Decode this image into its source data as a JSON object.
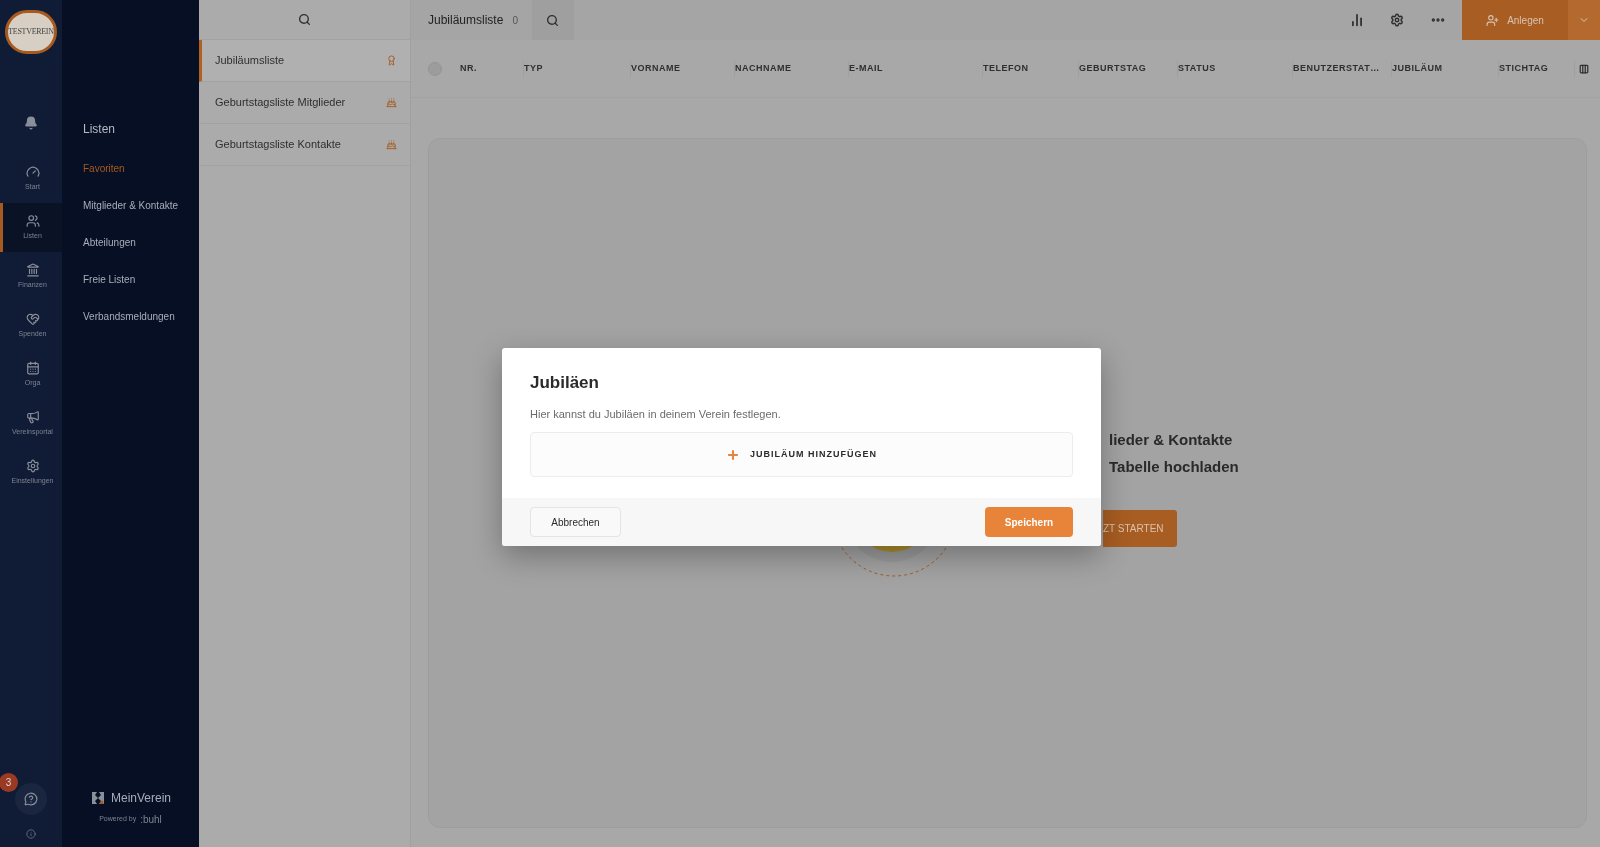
{
  "rail": {
    "logo_text": "TESTVEREIN",
    "items": [
      {
        "kind": "gauge",
        "label": "Start",
        "selected": false
      },
      {
        "kind": "users",
        "label": "Listen",
        "selected": true
      },
      {
        "kind": "bank",
        "label": "Finanzen",
        "selected": false
      },
      {
        "kind": "heart",
        "label": "Spenden",
        "selected": false
      },
      {
        "kind": "calendar",
        "label": "Orga",
        "selected": false
      },
      {
        "kind": "megaphone",
        "label": "Vereinsportal",
        "selected": false
      },
      {
        "kind": "gear",
        "label": "Einstellungen",
        "selected": false
      }
    ],
    "chat_badge": "3"
  },
  "submenu": {
    "title": "Listen",
    "items": [
      {
        "label": "Favoriten",
        "selected": true
      },
      {
        "label": "Mitglieder & Kontakte",
        "selected": false
      },
      {
        "label": "Abteilungen",
        "selected": false
      },
      {
        "label": "Freie Listen",
        "selected": false
      },
      {
        "label": "Verbandsmeldungen",
        "selected": false
      }
    ],
    "brand": "MeinVerein",
    "powered_by": "Powered by",
    "powered_brand": ":buhl"
  },
  "lists": [
    {
      "label": "Jubiläumsliste",
      "kind": "award",
      "selected": true
    },
    {
      "label": "Geburtstagsliste Mitglieder",
      "kind": "cake",
      "selected": false
    },
    {
      "label": "Geburtstagsliste Kontakte",
      "kind": "cake",
      "selected": false
    }
  ],
  "topbar": {
    "title": "Jubiläumsliste",
    "count": "0",
    "create_button": "Anlegen"
  },
  "table": {
    "select_all": {
      "checked": false
    },
    "columns": [
      "NR.",
      "TYP",
      "VORNAME",
      "NACHNAME",
      "E-MAIL",
      "TELEFON",
      "GEBURTSTAG",
      "STATUS",
      "BENUTZERSTAT…",
      "JUBILÄUM",
      "STICHTAG"
    ]
  },
  "empty_state": {
    "lines": [
      "lieder & Kontakte",
      "Tabelle hochladen"
    ],
    "button": "ZT STARTEN"
  },
  "dialog": {
    "title": "Jubiläen",
    "text": "Hier kannst du Jubiläen in deinem Verein festlegen.",
    "add_button": "JUBILÄUM HINZUFÜGEN",
    "cancel_button": "Abbrechen",
    "save_button": "Speichern"
  }
}
